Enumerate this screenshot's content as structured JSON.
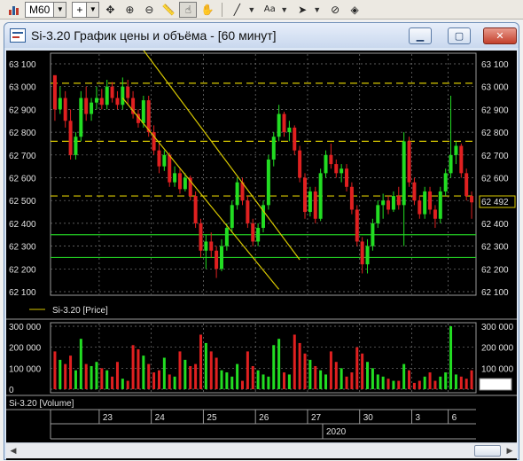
{
  "toolbar": {
    "interval_value": "M60",
    "text_tool_label": "Aa"
  },
  "window": {
    "title": "Si-3.20 График цены и объёма - [60 минут]"
  },
  "price_panel": {
    "y_ticks": [
      "63 100",
      "63 000",
      "62 900",
      "62 800",
      "62 700",
      "62 600",
      "62 500",
      "62 400",
      "62 300",
      "62 200",
      "62 100"
    ],
    "current_price_label": "62 492",
    "legend": "Si-3.20 [Price]",
    "ylim": [
      62100,
      63100
    ],
    "colors": {
      "up": "#22dd22",
      "down": "#e02020",
      "level": "#d8c800",
      "support": "#22cc22",
      "grid": "#7a7a7a"
    }
  },
  "volume_panel": {
    "y_ticks": [
      "300 000",
      "200 000",
      "100 000",
      "0"
    ],
    "legend": "Si-3.20 [Volume]",
    "ylim": [
      0,
      300000
    ]
  },
  "date_axis": {
    "labels": [
      "23",
      "24",
      "25",
      "26",
      "27",
      "30",
      "3",
      "6"
    ],
    "year": "2020"
  },
  "chart_data": {
    "type": "candlestick",
    "ylim": [
      62100,
      63100
    ],
    "horizontal_levels_dashed": [
      63015,
      62760,
      62520
    ],
    "horizontal_levels_solid": [
      62350,
      62250
    ],
    "trend_channel": [
      {
        "from": {
          "bar": 17,
          "price": 63160
        },
        "to": {
          "bar": 47,
          "price": 62240
        }
      },
      {
        "from": {
          "bar": 13,
          "price": 62950
        },
        "to": {
          "bar": 43,
          "price": 62110
        }
      }
    ],
    "candles": [
      [
        63050,
        63050,
        62850,
        62900
      ],
      [
        62900,
        63000,
        62880,
        62950
      ],
      [
        62950,
        62980,
        62820,
        62850
      ],
      [
        62850,
        62900,
        62680,
        62700
      ],
      [
        62700,
        62800,
        62680,
        62780
      ],
      [
        62780,
        62980,
        62760,
        62950
      ],
      [
        62950,
        63000,
        62850,
        62880
      ],
      [
        62880,
        62950,
        62850,
        62930
      ],
      [
        62930,
        63000,
        62900,
        62950
      ],
      [
        62950,
        62990,
        62900,
        62920
      ],
      [
        62920,
        63030,
        62900,
        63000
      ],
      [
        63000,
        63020,
        62930,
        62950
      ],
      [
        62950,
        62980,
        62900,
        62920
      ],
      [
        62920,
        63040,
        62900,
        63000
      ],
      [
        63000,
        63030,
        62920,
        62950
      ],
      [
        62950,
        62980,
        62860,
        62880
      ],
      [
        62880,
        62900,
        62820,
        62840
      ],
      [
        62840,
        62960,
        62820,
        62940
      ],
      [
        62940,
        62960,
        62780,
        62800
      ],
      [
        62800,
        62830,
        62700,
        62720
      ],
      [
        62720,
        62750,
        62620,
        62650
      ],
      [
        62650,
        62720,
        62630,
        62700
      ],
      [
        62700,
        62710,
        62560,
        62580
      ],
      [
        62580,
        62650,
        62560,
        62620
      ],
      [
        62620,
        62640,
        62530,
        62550
      ],
      [
        62550,
        62620,
        62540,
        62600
      ],
      [
        62600,
        62610,
        62500,
        62520
      ],
      [
        62520,
        62540,
        62380,
        62400
      ],
      [
        62400,
        62420,
        62250,
        62280
      ],
      [
        62280,
        62350,
        62200,
        62320
      ],
      [
        62320,
        62360,
        62250,
        62280
      ],
      [
        62280,
        62300,
        62160,
        62200
      ],
      [
        62200,
        62330,
        62190,
        62300
      ],
      [
        62300,
        62400,
        62280,
        62380
      ],
      [
        62380,
        62500,
        62360,
        62480
      ],
      [
        62480,
        62600,
        62460,
        62580
      ],
      [
        62580,
        62600,
        62480,
        62500
      ],
      [
        62500,
        62520,
        62380,
        62400
      ],
      [
        62400,
        62420,
        62300,
        62320
      ],
      [
        62320,
        62400,
        62300,
        62380
      ],
      [
        62380,
        62500,
        62360,
        62480
      ],
      [
        62480,
        62700,
        62460,
        62680
      ],
      [
        62680,
        62800,
        62650,
        62780
      ],
      [
        62780,
        62920,
        62760,
        62880
      ],
      [
        62880,
        62890,
        62780,
        62800
      ],
      [
        62800,
        62850,
        62760,
        62820
      ],
      [
        62820,
        62830,
        62700,
        62720
      ],
      [
        62720,
        62740,
        62580,
        62600
      ],
      [
        62600,
        62620,
        62420,
        62450
      ],
      [
        62450,
        62560,
        62430,
        62540
      ],
      [
        62540,
        62560,
        62400,
        62420
      ],
      [
        62420,
        62640,
        62410,
        62620
      ],
      [
        62620,
        62720,
        62600,
        62700
      ],
      [
        62700,
        62750,
        62640,
        62660
      ],
      [
        62660,
        62680,
        62600,
        62620
      ],
      [
        62620,
        62660,
        62580,
        62640
      ],
      [
        62640,
        62660,
        62540,
        62560
      ],
      [
        62560,
        62580,
        62440,
        62460
      ],
      [
        62460,
        62480,
        62300,
        62320
      ],
      [
        62320,
        62340,
        62180,
        62220
      ],
      [
        62220,
        62330,
        62180,
        62300
      ],
      [
        62300,
        62420,
        62280,
        62400
      ],
      [
        62400,
        62500,
        62380,
        62480
      ],
      [
        62480,
        62530,
        62420,
        62500
      ],
      [
        62500,
        62520,
        62440,
        62460
      ],
      [
        62460,
        62540,
        62450,
        62520
      ],
      [
        62520,
        62560,
        62460,
        62480
      ],
      [
        62480,
        62800,
        62300,
        62760
      ],
      [
        62760,
        62780,
        62560,
        62580
      ],
      [
        62580,
        62600,
        62480,
        62500
      ],
      [
        62500,
        62520,
        62420,
        62440
      ],
      [
        62440,
        62560,
        62420,
        62540
      ],
      [
        62540,
        62560,
        62440,
        62460
      ],
      [
        62460,
        62480,
        62380,
        62420
      ],
      [
        62420,
        62560,
        62400,
        62540
      ],
      [
        62540,
        62640,
        62520,
        62620
      ],
      [
        62620,
        62960,
        62600,
        62700
      ],
      [
        62700,
        62760,
        62660,
        62740
      ],
      [
        62740,
        62750,
        62600,
        62620
      ],
      [
        62620,
        62640,
        62500,
        62520
      ],
      [
        62520,
        62540,
        62420,
        62492
      ]
    ],
    "volumes": [
      180000,
      140000,
      120000,
      160000,
      90000,
      240000,
      120000,
      110000,
      130000,
      100000,
      90000,
      60000,
      130000,
      50000,
      40000,
      210000,
      190000,
      160000,
      120000,
      80000,
      90000,
      150000,
      70000,
      60000,
      180000,
      140000,
      110000,
      120000,
      260000,
      220000,
      180000,
      150000,
      90000,
      80000,
      60000,
      120000,
      40000,
      180000,
      110000,
      90000,
      70000,
      60000,
      210000,
      240000,
      80000,
      70000,
      260000,
      220000,
      170000,
      140000,
      110000,
      90000,
      70000,
      180000,
      130000,
      100000,
      60000,
      80000,
      200000,
      170000,
      130000,
      100000,
      70000,
      60000,
      50000,
      40000,
      40000,
      120000,
      90000,
      30000,
      40000,
      60000,
      80000,
      40000,
      60000,
      80000,
      300000,
      70000,
      60000,
      50000,
      90000
    ]
  }
}
